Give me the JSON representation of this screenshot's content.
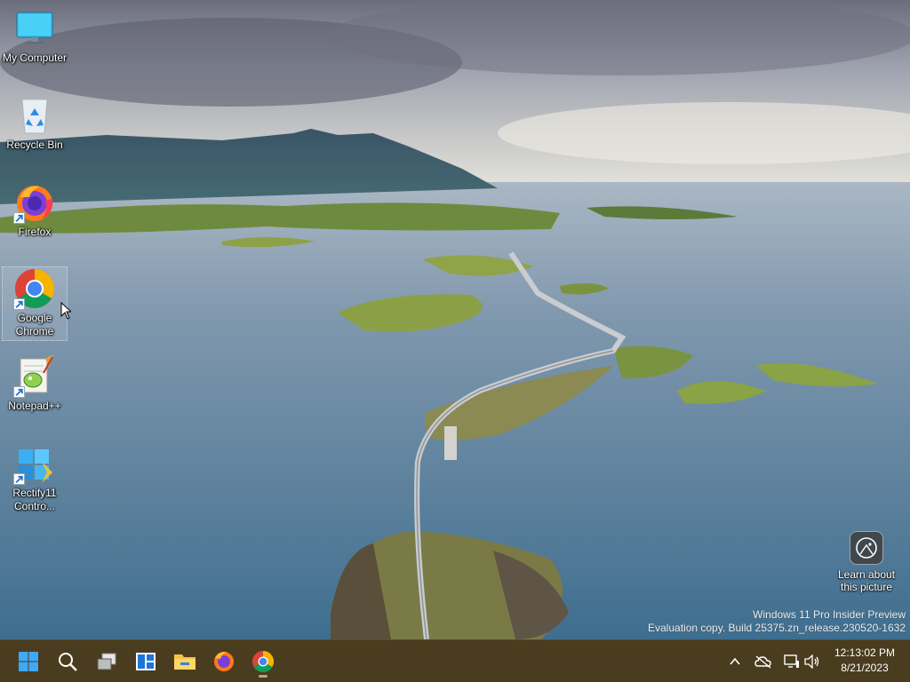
{
  "desktop": {
    "icons": [
      {
        "name": "my-computer",
        "label": "My Computer"
      },
      {
        "name": "recycle-bin",
        "label": "Recycle Bin"
      },
      {
        "name": "firefox",
        "label": "Firefox"
      },
      {
        "name": "google-chrome",
        "label": "Google Chrome"
      },
      {
        "name": "notepad-plus-plus",
        "label": "Notepad++"
      },
      {
        "name": "rectify11",
        "label": "Rectify11 Contro..."
      }
    ],
    "learn_about_picture": "Learn about this picture",
    "watermark": {
      "line1": "Windows 11 Pro Insider Preview",
      "line2": "Evaluation copy. Build 25375.zn_release.230520-1632"
    }
  },
  "taskbar": {
    "buttons": [
      {
        "name": "start",
        "icon": "windows-logo-icon"
      },
      {
        "name": "search",
        "icon": "search-icon"
      },
      {
        "name": "task-view",
        "icon": "task-view-icon"
      },
      {
        "name": "widgets",
        "icon": "widgets-icon"
      },
      {
        "name": "file-explorer",
        "icon": "folder-icon"
      },
      {
        "name": "firefox",
        "icon": "firefox-icon"
      },
      {
        "name": "chrome",
        "icon": "chrome-icon"
      }
    ],
    "tray": {
      "icons": [
        "chevron-up-icon",
        "cloud-off-icon",
        "network-icon",
        "volume-icon"
      ],
      "time": "12:13:02 PM",
      "date": "8/21/2023"
    }
  },
  "colors": {
    "taskbar_bg": "#4a3c1f",
    "accent": "#1e90ff"
  }
}
